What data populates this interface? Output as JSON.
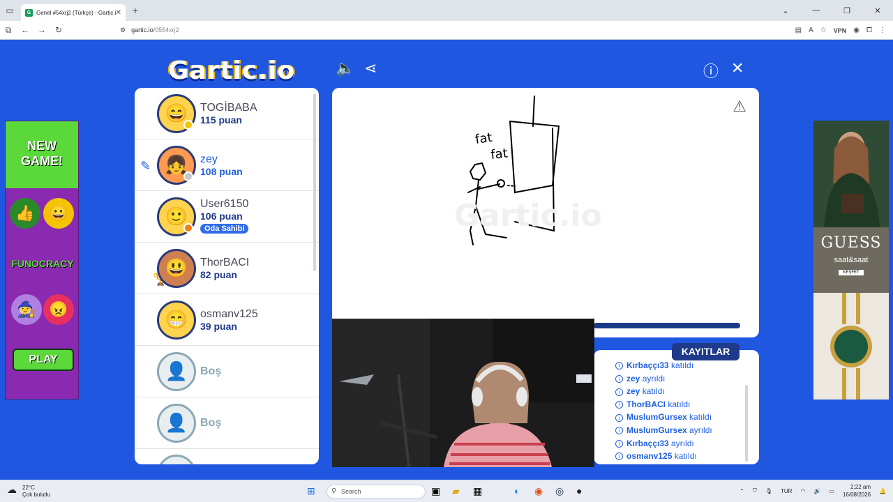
{
  "browser": {
    "tab_title": "Genel #54xrj2 (Türkçe) - Gartic.i",
    "url_host": "gartic.io",
    "url_path": "/0554xrj2",
    "vpn_label": "VPN"
  },
  "game": {
    "logo": "Gartic.io",
    "players": [
      {
        "name": "TOGİBABA",
        "points": "115 puan",
        "status_color": "#f4c400"
      },
      {
        "name": "zey",
        "points": "108 puan",
        "status_color": "#c8c8c8",
        "drawing": true
      },
      {
        "name": "User6150",
        "points": "106 puan",
        "status_color": "#e8801a",
        "badge": "Oda Sahibi"
      },
      {
        "name": "ThorBACI",
        "points": "82 puan",
        "trophy": "1"
      },
      {
        "name": "osmanv125",
        "points": "39 puan"
      }
    ],
    "empty_slots": [
      "Boş",
      "Boş"
    ],
    "canvas_text": [
      "fat",
      "fat"
    ],
    "logs_title": "KAYITLAR",
    "logs": [
      {
        "user": "Kırbaççı33",
        "action": "katıldı"
      },
      {
        "user": "zey",
        "action": "ayrıldı"
      },
      {
        "user": "zey",
        "action": "katıldı"
      },
      {
        "user": "ThorBACI",
        "action": "katıldı"
      },
      {
        "user": "MuslumGursex",
        "action": "katıldı"
      },
      {
        "user": "MuslumGursex",
        "action": "ayrıldı"
      },
      {
        "user": "Kırbaççı33",
        "action": "ayrıldı"
      },
      {
        "user": "osmanv125",
        "action": "katıldı"
      }
    ]
  },
  "ads": {
    "left": {
      "banner": "NEW GAME!",
      "brand": "FUNOCRACY",
      "cta": "PLAY"
    },
    "right": {
      "brand": "GUESS",
      "sub": "saat&saat",
      "cta": "KEŞFET"
    }
  },
  "taskbar": {
    "temp": "22°C",
    "weather": "Çok bulutlu",
    "search_placeholder": "Search",
    "lang": "TUR",
    "time": "2:22 am",
    "date": "16/08/2026"
  }
}
